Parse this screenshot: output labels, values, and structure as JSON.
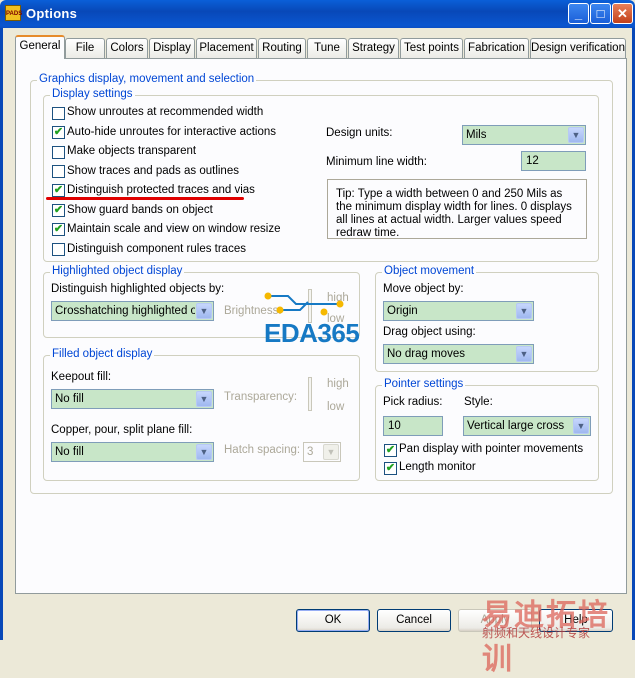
{
  "window": {
    "title": "Options",
    "icon_text": "PADS"
  },
  "tabs": [
    {
      "label": "General",
      "active": true
    },
    {
      "label": "File"
    },
    {
      "label": "Colors"
    },
    {
      "label": "Display"
    },
    {
      "label": "Placement"
    },
    {
      "label": "Routing"
    },
    {
      "label": "Tune"
    },
    {
      "label": "Strategy"
    },
    {
      "label": "Test points"
    },
    {
      "label": "Fabrication"
    },
    {
      "label": "Design verification"
    }
  ],
  "graphics": {
    "title": "Graphics display, movement and selection",
    "display_settings": {
      "title": "Display settings",
      "items": [
        {
          "label": "Show unroutes at recommended width",
          "checked": false
        },
        {
          "label": "Auto-hide unroutes for interactive actions",
          "checked": true
        },
        {
          "label": "Make objects transparent",
          "checked": false
        },
        {
          "label": "Show traces and pads as outlines",
          "checked": false
        },
        {
          "label": "Distinguish protected traces and vias",
          "checked": true
        },
        {
          "label": "Show guard bands on object",
          "checked": true
        },
        {
          "label": "Maintain scale and view on window resize",
          "checked": true
        },
        {
          "label": "Distinguish component rules traces",
          "checked": false
        }
      ],
      "design_units_label": "Design units:",
      "design_units_value": "Mils",
      "min_line_width_label": "Minimum line width:",
      "min_line_width_value": "12",
      "tip": "Tip: Type a width between 0 and 250 Mils as the minimum display width for lines. 0 displays all lines at actual width. Larger values speed redraw time."
    },
    "highlighted": {
      "title": "Highlighted object display",
      "distinguish_label": "Distinguish highlighted objects by:",
      "distinguish_value": "Crosshatching highlighted obje",
      "brightness_label": "Brightness:",
      "high_label": "high",
      "low_label": "low"
    },
    "filled": {
      "title": "Filled object display",
      "keepout_label": "Keepout fill:",
      "keepout_value": "No fill",
      "transparency_label": "Transparency:",
      "high_label": "high",
      "low_label": "low",
      "copper_label": "Copper, pour, split plane fill:",
      "copper_value": "No fill",
      "hatch_label": "Hatch spacing:",
      "hatch_value": "3"
    },
    "movement": {
      "title": "Object movement",
      "move_label": "Move object by:",
      "move_value": "Origin",
      "drag_label": "Drag object using:",
      "drag_value": "No drag moves"
    },
    "pointer": {
      "title": "Pointer settings",
      "pick_label": "Pick radius:",
      "pick_value": "10",
      "style_label": "Style:",
      "style_value": "Vertical large cross",
      "pan_label": "Pan display with pointer movements",
      "pan_checked": true,
      "length_label": "Length monitor",
      "length_checked": true
    }
  },
  "buttons": {
    "ok": "OK",
    "cancel": "Cancel",
    "apply": "Apply",
    "help": "Help"
  },
  "watermark": {
    "eda": "EDA365",
    "cn": "易迪拓培训",
    "cn_sub": "射频和天线设计专家"
  }
}
